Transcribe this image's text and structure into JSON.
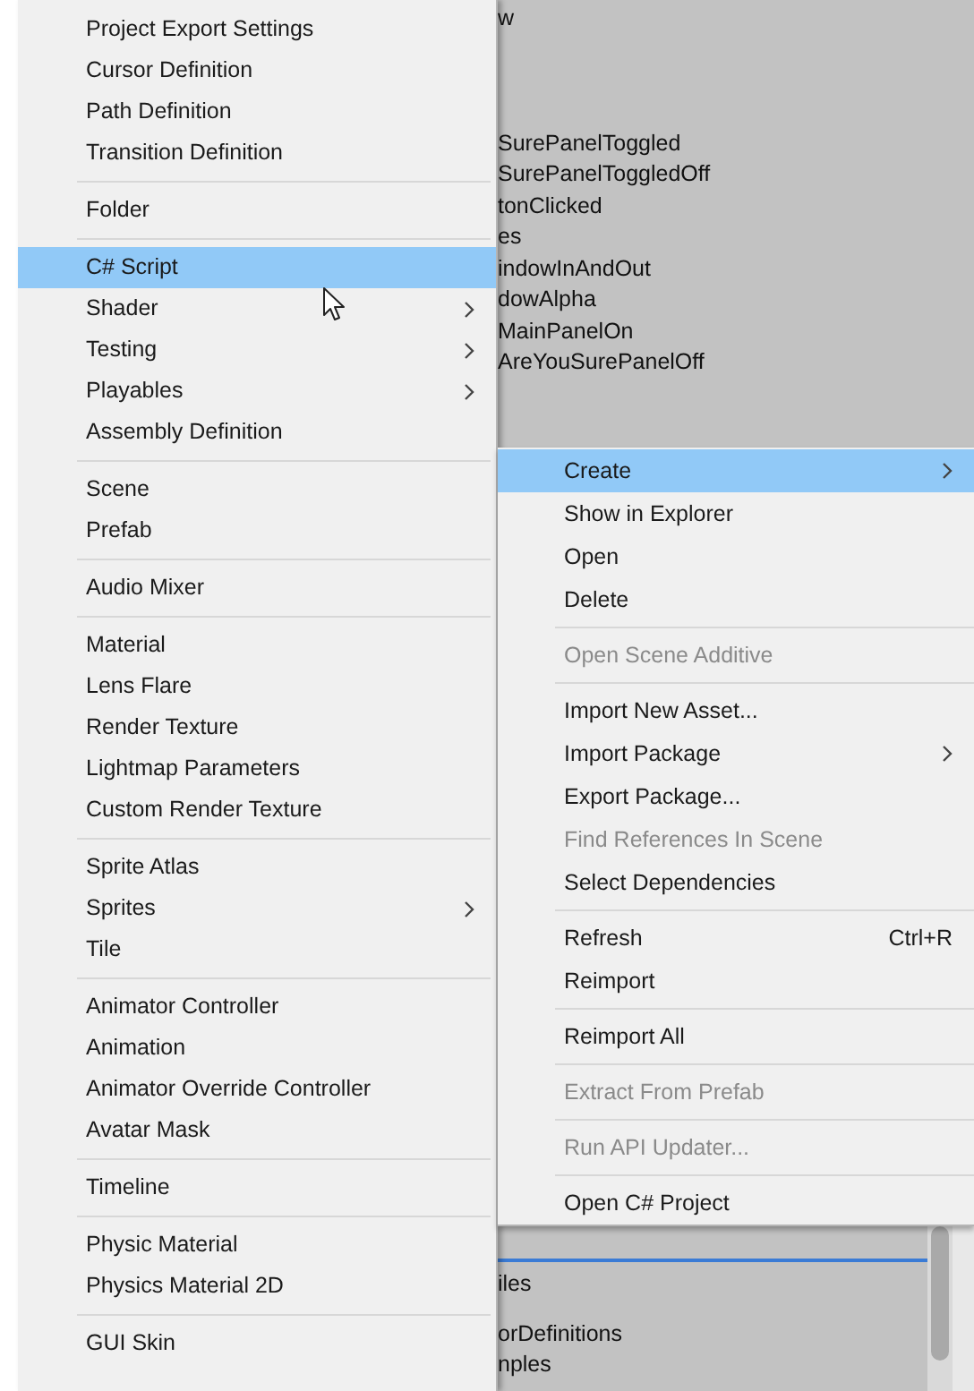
{
  "background_list": {
    "top_lines": [
      {
        "text": "w"
      },
      {
        "text": "SurePanelToggled"
      },
      {
        "text": "SurePanelToggledOff"
      },
      {
        "text": "tonClicked"
      },
      {
        "text": "es"
      },
      {
        "text": "indowInAndOut"
      },
      {
        "text": "dowAlpha"
      },
      {
        "text": "MainPanelOn"
      },
      {
        "text": "AreYouSurePanelOff"
      }
    ],
    "bottom_lines": [
      {
        "text": "iles"
      },
      {
        "text": "orDefinitions"
      },
      {
        "text": "nples"
      }
    ]
  },
  "create_menu": {
    "groups": [
      [
        {
          "label": "Project Export Settings",
          "selected": false,
          "submenu": false
        },
        {
          "label": "Cursor Definition",
          "selected": false,
          "submenu": false
        },
        {
          "label": "Path Definition",
          "selected": false,
          "submenu": false
        },
        {
          "label": "Transition Definition",
          "selected": false,
          "submenu": false
        }
      ],
      [
        {
          "label": "Folder",
          "selected": false,
          "submenu": false
        }
      ],
      [
        {
          "label": "C# Script",
          "selected": true,
          "submenu": false
        },
        {
          "label": "Shader",
          "selected": false,
          "submenu": true
        },
        {
          "label": "Testing",
          "selected": false,
          "submenu": true
        },
        {
          "label": "Playables",
          "selected": false,
          "submenu": true
        },
        {
          "label": "Assembly Definition",
          "selected": false,
          "submenu": false
        }
      ],
      [
        {
          "label": "Scene",
          "selected": false,
          "submenu": false
        },
        {
          "label": "Prefab",
          "selected": false,
          "submenu": false
        }
      ],
      [
        {
          "label": "Audio Mixer",
          "selected": false,
          "submenu": false
        }
      ],
      [
        {
          "label": "Material",
          "selected": false,
          "submenu": false
        },
        {
          "label": "Lens Flare",
          "selected": false,
          "submenu": false
        },
        {
          "label": "Render Texture",
          "selected": false,
          "submenu": false
        },
        {
          "label": "Lightmap Parameters",
          "selected": false,
          "submenu": false
        },
        {
          "label": "Custom Render Texture",
          "selected": false,
          "submenu": false
        }
      ],
      [
        {
          "label": "Sprite Atlas",
          "selected": false,
          "submenu": false
        },
        {
          "label": "Sprites",
          "selected": false,
          "submenu": true
        },
        {
          "label": "Tile",
          "selected": false,
          "submenu": false
        }
      ],
      [
        {
          "label": "Animator Controller",
          "selected": false,
          "submenu": false
        },
        {
          "label": "Animation",
          "selected": false,
          "submenu": false
        },
        {
          "label": "Animator Override Controller",
          "selected": false,
          "submenu": false
        },
        {
          "label": "Avatar Mask",
          "selected": false,
          "submenu": false
        }
      ],
      [
        {
          "label": "Timeline",
          "selected": false,
          "submenu": false
        }
      ],
      [
        {
          "label": "Physic Material",
          "selected": false,
          "submenu": false
        },
        {
          "label": "Physics Material 2D",
          "selected": false,
          "submenu": false
        }
      ],
      [
        {
          "label": "GUI Skin",
          "selected": false,
          "submenu": false
        }
      ]
    ]
  },
  "context_menu": {
    "groups": [
      [
        {
          "label": "Create",
          "selected": true,
          "disabled": false,
          "submenu": true
        },
        {
          "label": "Show in Explorer",
          "selected": false,
          "disabled": false,
          "submenu": false
        },
        {
          "label": "Open",
          "selected": false,
          "disabled": false,
          "submenu": false
        },
        {
          "label": "Delete",
          "selected": false,
          "disabled": false,
          "submenu": false
        }
      ],
      [
        {
          "label": "Open Scene Additive",
          "selected": false,
          "disabled": true,
          "submenu": false
        }
      ],
      [
        {
          "label": "Import New Asset...",
          "selected": false,
          "disabled": false,
          "submenu": false
        },
        {
          "label": "Import Package",
          "selected": false,
          "disabled": false,
          "submenu": true
        },
        {
          "label": "Export Package...",
          "selected": false,
          "disabled": false,
          "submenu": false
        },
        {
          "label": "Find References In Scene",
          "selected": false,
          "disabled": true,
          "submenu": false
        },
        {
          "label": "Select Dependencies",
          "selected": false,
          "disabled": false,
          "submenu": false
        }
      ],
      [
        {
          "label": "Refresh",
          "shortcut": "Ctrl+R",
          "selected": false,
          "disabled": false,
          "submenu": false
        },
        {
          "label": "Reimport",
          "selected": false,
          "disabled": false,
          "submenu": false
        }
      ],
      [
        {
          "label": "Reimport All",
          "selected": false,
          "disabled": false,
          "submenu": false
        }
      ],
      [
        {
          "label": "Extract From Prefab",
          "selected": false,
          "disabled": true,
          "submenu": false
        }
      ],
      [
        {
          "label": "Run API Updater...",
          "selected": false,
          "disabled": true,
          "submenu": false
        }
      ],
      [
        {
          "label": "Open C# Project",
          "selected": false,
          "disabled": false,
          "submenu": false
        }
      ]
    ]
  }
}
